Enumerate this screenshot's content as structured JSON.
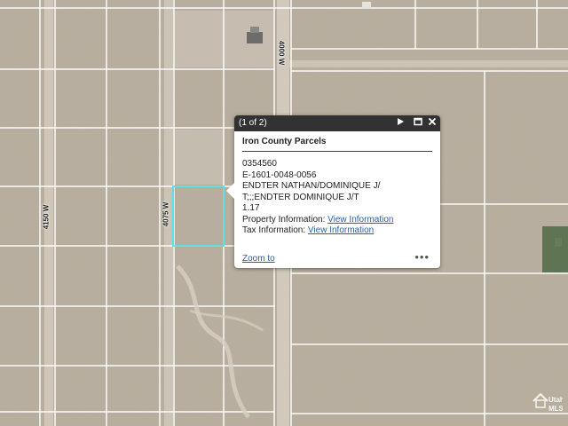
{
  "map": {
    "roads": {
      "w4150": "4150 W",
      "w4075": "4075 W",
      "w4000": "4000 W"
    },
    "highlight_color": "#5ee0e6",
    "parcel_line_color": "#ffffff"
  },
  "popup": {
    "pager": "(1 of 2)",
    "title": "Iron County Parcels",
    "fields": {
      "parcel_id": "0354560",
      "account": "E-1601-0048-0056",
      "owner_line1": "ENDTER NATHAN/DOMINIQUE J/",
      "owner_line2": "T;;;ENDTER DOMINIQUE J/T",
      "acres": "1.17",
      "property_label": "Property Information: ",
      "property_link": "View Information",
      "tax_label": "Tax Information: ",
      "tax_link": "View Information"
    },
    "zoom_to": "Zoom to",
    "icons": {
      "next": "next-icon",
      "maximize": "maximize-icon",
      "close": "close-icon",
      "more": "more-icon"
    }
  },
  "watermark": {
    "text_line1": "Utah",
    "text_line2": "MLS"
  }
}
